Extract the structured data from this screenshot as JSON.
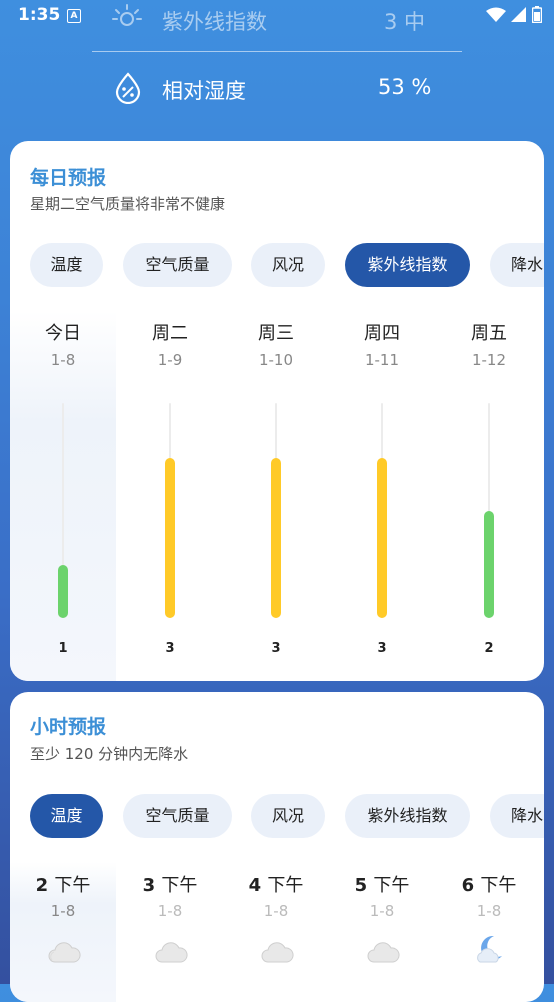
{
  "status_bar": {
    "time": "1:35",
    "a_icon": "A"
  },
  "top": {
    "uv": {
      "label": "紫外线指数",
      "value": "3 中"
    },
    "humidity": {
      "label": "相对湿度",
      "value": "53 %"
    }
  },
  "daily": {
    "title": "每日预报",
    "subtitle": "星期二空气质量将非常不健康",
    "chips": [
      "温度",
      "空气质量",
      "风况",
      "紫外线指数",
      "降水"
    ],
    "active_chip": 3,
    "days": [
      {
        "name": "今日",
        "date": "1-8",
        "uv": 1
      },
      {
        "name": "周二",
        "date": "1-9",
        "uv": 3
      },
      {
        "name": "周三",
        "date": "1-10",
        "uv": 3
      },
      {
        "name": "周四",
        "date": "1-11",
        "uv": 3
      },
      {
        "name": "周五",
        "date": "1-12",
        "uv": 2
      }
    ],
    "uv_max": 4,
    "colors": {
      "low": "#6cd36c",
      "moderate": "#ffca28"
    }
  },
  "hourly": {
    "title": "小时预报",
    "subtitle": "至少 120 分钟内无降水",
    "chips": [
      "温度",
      "空气质量",
      "风况",
      "紫外线指数",
      "降水"
    ],
    "active_chip": 0,
    "hours": [
      {
        "hour": "2",
        "unit": "下午",
        "date": "1-8",
        "icon": "cloudy-icon"
      },
      {
        "hour": "3",
        "unit": "下午",
        "date": "1-8",
        "icon": "cloudy-icon"
      },
      {
        "hour": "4",
        "unit": "下午",
        "date": "1-8",
        "icon": "cloudy-icon"
      },
      {
        "hour": "5",
        "unit": "下午",
        "date": "1-8",
        "icon": "cloudy-icon"
      },
      {
        "hour": "6",
        "unit": "下午",
        "date": "1-8",
        "icon": "moon-cloud-icon"
      }
    ]
  }
}
